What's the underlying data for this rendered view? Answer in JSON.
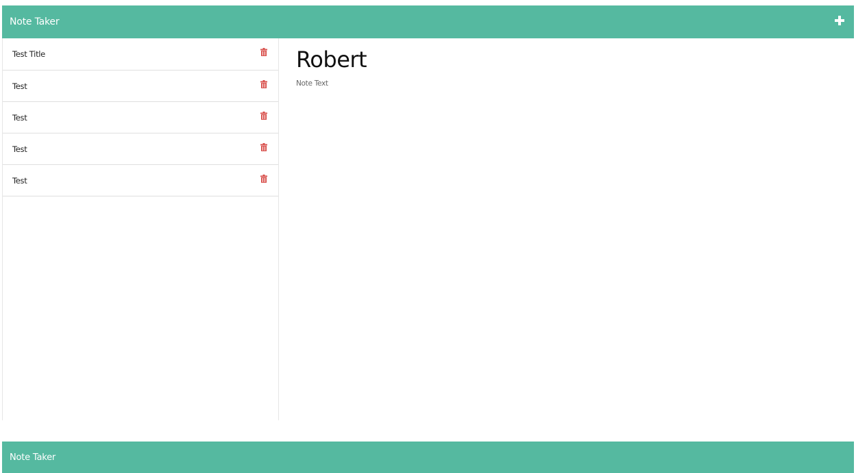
{
  "navbar": {
    "brand": "Note Taker"
  },
  "notes": [
    {
      "title": "Test Title"
    },
    {
      "title": "Test"
    },
    {
      "title": "Test"
    },
    {
      "title": "Test"
    },
    {
      "title": "Test"
    }
  ],
  "active_note": {
    "title": "Robert",
    "text": "Note Text"
  },
  "footer": {
    "brand": "Note Taker"
  },
  "colors": {
    "accent": "#55b9a0",
    "delete": "#d9534f"
  },
  "icons": {
    "new_note": "plus-icon",
    "delete_note": "trash-icon"
  }
}
